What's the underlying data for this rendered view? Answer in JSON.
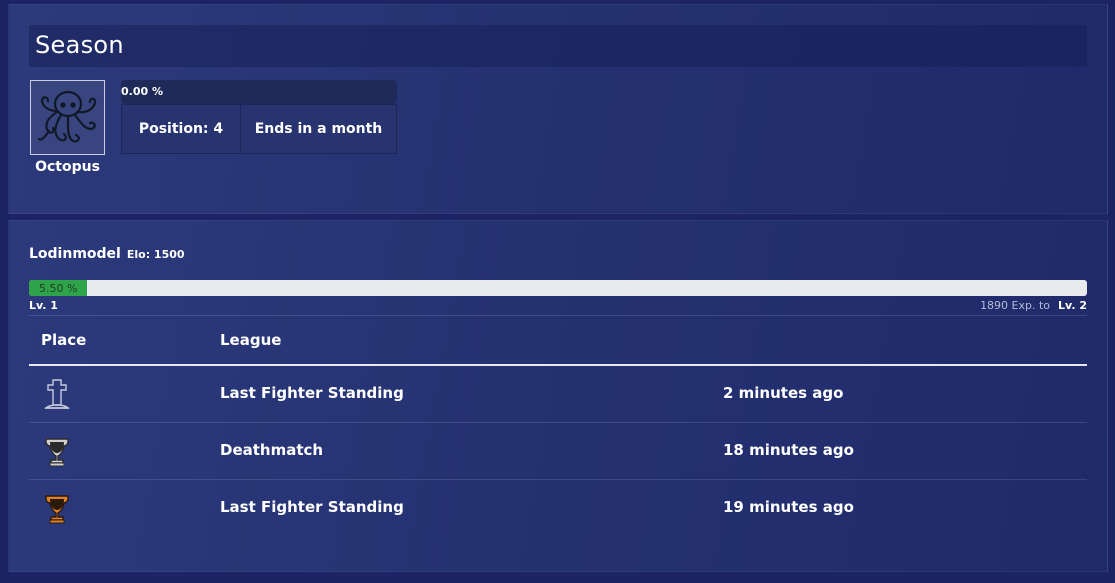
{
  "season": {
    "title": "Season",
    "avatar_icon": "octopus-icon",
    "avatar_label": "Octopus",
    "progress_percent": 0,
    "progress_label": "0.00 %",
    "position_label": "Position: 4",
    "ends_label": "Ends in a month"
  },
  "player": {
    "name": "Lodinmodel",
    "elo": "Elo: 1500",
    "xp_percent": 5.5,
    "xp_label": "5.50 %",
    "level_current": "Lv. 1",
    "xp_to_next": "1890 Exp. to",
    "level_next": "Lv. 2"
  },
  "table": {
    "headers": {
      "place": "Place",
      "league": "League"
    },
    "rows": [
      {
        "place_icon": "tombstone-icon",
        "league": "Last Fighter Standing",
        "time": "2 minutes ago"
      },
      {
        "place_icon": "silver-trophy-icon",
        "league": "Deathmatch",
        "time": "18 minutes ago"
      },
      {
        "place_icon": "bronze-trophy-icon",
        "league": "Last Fighter Standing",
        "time": "19 minutes ago"
      }
    ]
  },
  "colors": {
    "background": "#1c2466",
    "panel": "#2a3777",
    "progress_green": "#2fa34a",
    "silver": "#c8c8c8",
    "bronze": "#e0822a"
  }
}
